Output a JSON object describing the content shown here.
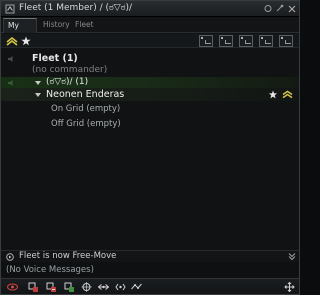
{
  "window": {
    "title": "Fleet (1 Member) / (ಠ▽ಠ)/",
    "icons": {
      "app": "fleet-icon",
      "minimize": "minimize-icon",
      "close": "close-icon"
    }
  },
  "tabs": [
    {
      "label": "My Fleet",
      "active": true
    },
    {
      "label": "History",
      "active": false
    },
    {
      "label": "Fleet Finder",
      "active": false
    }
  ],
  "toolbar": {
    "left_icons": [
      "wing-chevron-icon",
      "star-icon"
    ],
    "squad_buttons": 5
  },
  "tree": {
    "fleet": {
      "name": "Fleet (1)",
      "commander": "(no commander)"
    },
    "wing": {
      "name": "(ಠ▽ಠ)/ (1)"
    },
    "member": {
      "name": "Neonen Enderas",
      "icons": [
        "star-icon",
        "wing-commander-icon"
      ]
    },
    "grid": [
      {
        "label": "On Grid (empty)"
      },
      {
        "label": "Off Grid (empty)"
      }
    ]
  },
  "status": {
    "message": "Fleet is now Free-Move"
  },
  "voice": {
    "message": "(No Voice Messages)"
  },
  "bottom_bar_icons": [
    "eye-icon",
    "broadcast-target-icon",
    "broadcast-align-icon",
    "broadcast-warp-icon",
    "broadcast-jump-icon",
    "broadcast-location-icon",
    "broadcast-travel-icon",
    "broadcast-voice-icon",
    "broadcast-need-backup-icon",
    "move-icon"
  ],
  "colors": {
    "accent_yellow": "#d9c84a",
    "wing_green": "#1a3218",
    "background": "#101213"
  }
}
